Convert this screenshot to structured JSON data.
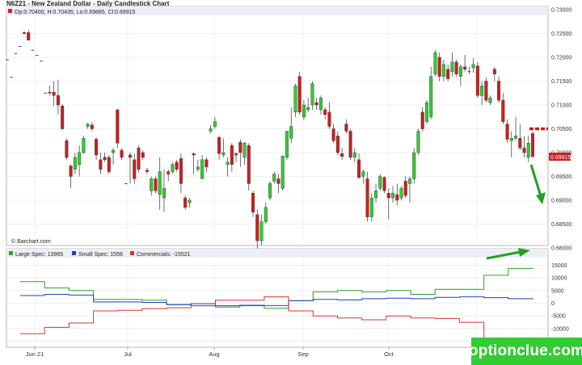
{
  "header": {
    "title": "N6Z21 - New Zealand Dollar - Daily Candlestick Chart",
    "ohlc": "Op:0.70400, H:0.70435, Lo:0.69885, Cl:0.69915",
    "last_price": "0.69915",
    "copyright": "© Barchart.com"
  },
  "watermark": "optionclue.com",
  "colors": {
    "up": "#33cc33",
    "down": "#cc1f1f",
    "large_spec": "#2ca02c",
    "small_spec": "#1f3fbf",
    "commercials": "#e0302a",
    "arrow": "#22a022",
    "level": "#dd1111"
  },
  "chart_data": [
    {
      "type": "candlestick",
      "title": "N6Z21 - New Zealand Dollar - Daily Candlestick Chart",
      "x_ticks": [
        "Jun 21",
        "Jul",
        "Aug",
        "Sep",
        "Oct"
      ],
      "ylim": [
        0.68,
        0.73
      ],
      "y_ticks": [
        "0.73000",
        "0.72500",
        "0.72000",
        "0.71500",
        "0.71000",
        "0.70500",
        "0.70000",
        "0.69500",
        "0.69000",
        "0.68500",
        "0.68000"
      ],
      "horizontal_level": 0.705,
      "last_price_label": "0.69915",
      "candles": [
        [
          0.7195,
          0.7195,
          0.7195,
          0.7195
        ],
        [
          0.7158,
          0.7158,
          0.7158,
          0.7158
        ],
        [
          0.7208,
          0.7208,
          0.7208,
          0.7208
        ],
        [
          0.7223,
          0.7223,
          0.7223,
          0.7223
        ],
        [
          0.7252,
          0.7255,
          0.7248,
          0.725
        ],
        [
          0.7252,
          0.7258,
          0.7235,
          0.7236
        ],
        [
          0.7215,
          0.7215,
          0.7215,
          0.7215
        ],
        [
          0.7204,
          0.7204,
          0.7204,
          0.7204
        ],
        [
          0.7192,
          0.7192,
          0.7192,
          0.7192
        ],
        [
          0.7125,
          0.7125,
          0.7125,
          0.7125
        ],
        [
          0.7127,
          0.714,
          0.712,
          0.7125
        ],
        [
          0.7127,
          0.715,
          0.7098,
          0.712
        ],
        [
          0.712,
          0.7153,
          0.708,
          0.71
        ],
        [
          0.7098,
          0.7102,
          0.7048,
          0.705
        ],
        [
          0.7025,
          0.703,
          0.6985,
          0.699
        ],
        [
          0.6972,
          0.6975,
          0.6925,
          0.695
        ],
        [
          0.6965,
          0.7,
          0.6955,
          0.699
        ],
        [
          0.6975,
          0.7015,
          0.695,
          0.7
        ],
        [
          0.7,
          0.7035,
          0.6998,
          0.703
        ],
        [
          0.7055,
          0.7062,
          0.705,
          0.706
        ],
        [
          0.7058,
          0.7064,
          0.7045,
          0.705
        ],
        [
          0.7028,
          0.7032,
          0.6985,
          0.6995
        ],
        [
          0.6985,
          0.7,
          0.6955,
          0.6965
        ],
        [
          0.699,
          0.7,
          0.698,
          0.6985
        ],
        [
          0.699,
          0.6995,
          0.6955,
          0.696
        ],
        [
          0.7,
          0.701,
          0.6975,
          0.7005
        ],
        [
          0.709,
          0.709,
          0.701,
          0.702
        ],
        [
          0.7005,
          0.701,
          0.6985,
          0.699
        ],
        [
          0.6935,
          0.6935,
          0.6935,
          0.6935
        ],
        [
          0.6995,
          0.7,
          0.6935,
          0.699
        ],
        [
          0.6985,
          0.6998,
          0.6935,
          0.6945
        ],
        [
          0.701,
          0.7015,
          0.6958,
          0.6965
        ],
        [
          0.7,
          0.7005,
          0.6985,
          0.699
        ],
        [
          0.6963,
          0.6968,
          0.6955,
          0.696
        ],
        [
          0.692,
          0.695,
          0.691,
          0.6945
        ],
        [
          0.6945,
          0.695,
          0.6915,
          0.692
        ],
        [
          0.6912,
          0.699,
          0.688,
          0.696
        ],
        [
          0.6905,
          0.6965,
          0.6875,
          0.6925
        ],
        [
          0.696,
          0.6965,
          0.694,
          0.6955
        ],
        [
          0.696,
          0.698,
          0.6955,
          0.6975
        ],
        [
          0.698,
          0.6985,
          0.696,
          0.6965
        ],
        [
          0.6988,
          0.6998,
          0.6915,
          0.6935
        ],
        [
          0.6905,
          0.691,
          0.688,
          0.6885
        ],
        [
          0.6895,
          0.6905,
          0.6885,
          0.69
        ],
        [
          0.6998,
          0.7,
          0.6955,
          0.6995
        ],
        [
          0.6965,
          0.6985,
          0.696,
          0.697
        ],
        [
          0.6945,
          0.6995,
          0.6945,
          0.6985
        ],
        [
          0.6985,
          0.699,
          0.696,
          0.697
        ],
        [
          0.7045,
          0.7058,
          0.704,
          0.705
        ],
        [
          0.7055,
          0.7075,
          0.705,
          0.7065
        ],
        [
          0.7032,
          0.7035,
          0.6985,
          0.6998
        ],
        [
          0.6995,
          0.703,
          0.699,
          0.7
        ],
        [
          0.6975,
          0.699,
          0.695,
          0.698
        ],
        [
          0.7015,
          0.702,
          0.696,
          0.6975
        ],
        [
          0.6998,
          0.7,
          0.698,
          0.6995
        ],
        [
          0.7022,
          0.7028,
          0.697,
          0.7
        ],
        [
          0.699,
          0.7022,
          0.6975,
          0.702
        ],
        [
          0.7015,
          0.702,
          0.692,
          0.6935
        ],
        [
          0.6915,
          0.692,
          0.6865,
          0.6875
        ],
        [
          0.687,
          0.688,
          0.6795,
          0.6815
        ],
        [
          0.6815,
          0.687,
          0.6805,
          0.6855
        ],
        [
          0.6855,
          0.6895,
          0.685,
          0.6885
        ],
        [
          0.6905,
          0.694,
          0.69,
          0.6935
        ],
        [
          0.694,
          0.696,
          0.6935,
          0.6955
        ],
        [
          0.6945,
          0.6955,
          0.6915,
          0.6935
        ],
        [
          0.6925,
          0.6993,
          0.692,
          0.6993
        ],
        [
          0.699,
          0.7045,
          0.6985,
          0.7045
        ],
        [
          0.703,
          0.7095,
          0.702,
          0.7055
        ],
        [
          0.7085,
          0.7145,
          0.7075,
          0.714
        ],
        [
          0.716,
          0.717,
          0.708,
          0.7085
        ],
        [
          0.7075,
          0.711,
          0.7068,
          0.71
        ],
        [
          0.709,
          0.7115,
          0.7085,
          0.7095
        ],
        [
          0.71,
          0.715,
          0.709,
          0.7145
        ],
        [
          0.7105,
          0.7115,
          0.709,
          0.71
        ],
        [
          0.709,
          0.712,
          0.708,
          0.7115
        ],
        [
          0.709,
          0.7095,
          0.707,
          0.708
        ],
        [
          0.7085,
          0.7105,
          0.705,
          0.7055
        ],
        [
          0.705,
          0.706,
          0.702,
          0.7025
        ],
        [
          0.7035,
          0.7045,
          0.6995,
          0.7
        ],
        [
          0.6998,
          0.701,
          0.6985,
          0.6992
        ],
        [
          0.706,
          0.707,
          0.704,
          0.7045
        ],
        [
          0.7045,
          0.705,
          0.6985,
          0.699
        ],
        [
          0.699,
          0.701,
          0.698,
          0.7
        ],
        [
          0.6985,
          0.6998,
          0.6945,
          0.6948
        ],
        [
          0.695,
          0.6965,
          0.6935,
          0.696
        ],
        [
          0.6945,
          0.696,
          0.6855,
          0.6865
        ],
        [
          0.6865,
          0.6915,
          0.6855,
          0.6905
        ],
        [
          0.6905,
          0.6935,
          0.6895,
          0.692
        ],
        [
          0.6925,
          0.6955,
          0.692,
          0.695
        ],
        [
          0.6948,
          0.695,
          0.6915,
          0.692
        ],
        [
          0.6915,
          0.6925,
          0.686,
          0.6905
        ],
        [
          0.6905,
          0.693,
          0.6895,
          0.6915
        ],
        [
          0.6912,
          0.6935,
          0.689,
          0.69
        ],
        [
          0.6905,
          0.693,
          0.69,
          0.6925
        ],
        [
          0.694,
          0.695,
          0.6905,
          0.691
        ],
        [
          0.6935,
          0.695,
          0.6895,
          0.6945
        ],
        [
          0.6945,
          0.701,
          0.6935,
          0.7
        ],
        [
          0.7,
          0.705,
          0.6995,
          0.7045
        ],
        [
          0.7085,
          0.7095,
          0.7045,
          0.705
        ],
        [
          0.7065,
          0.711,
          0.706,
          0.7105
        ],
        [
          0.7075,
          0.718,
          0.707,
          0.716
        ],
        [
          0.7165,
          0.7215,
          0.716,
          0.721
        ],
        [
          0.72,
          0.721,
          0.715,
          0.716
        ],
        [
          0.716,
          0.7195,
          0.715,
          0.7185
        ],
        [
          0.7175,
          0.7185,
          0.715,
          0.7155
        ],
        [
          0.717,
          0.721,
          0.716,
          0.719
        ],
        [
          0.719,
          0.7195,
          0.716,
          0.7165
        ],
        [
          0.716,
          0.7185,
          0.714,
          0.718
        ],
        [
          0.718,
          0.7205,
          0.717,
          0.7175
        ],
        [
          0.717,
          0.718,
          0.7165,
          0.717
        ],
        [
          0.7178,
          0.7198,
          0.7168,
          0.7185
        ],
        [
          0.7182,
          0.719,
          0.7115,
          0.712
        ],
        [
          0.712,
          0.715,
          0.71,
          0.714
        ],
        [
          0.715,
          0.7158,
          0.7105,
          0.711
        ],
        [
          0.7105,
          0.712,
          0.71,
          0.7115
        ],
        [
          0.7175,
          0.718,
          0.715,
          0.7165
        ],
        [
          0.715,
          0.716,
          0.7105,
          0.711
        ],
        [
          0.711,
          0.7125,
          0.706,
          0.7065
        ],
        [
          0.706,
          0.707,
          0.702,
          0.7028
        ],
        [
          0.7025,
          0.7045,
          0.699,
          0.703
        ],
        [
          0.703,
          0.7075,
          0.7025,
          0.7035
        ],
        [
          0.703,
          0.706,
          0.7005,
          0.701
        ],
        [
          0.701,
          0.7035,
          0.699,
          0.7
        ],
        [
          0.699,
          0.7035,
          0.698,
          0.702
        ],
        [
          0.704,
          0.7044,
          0.6988,
          0.6992
        ]
      ]
    },
    {
      "type": "line",
      "subtype": "step",
      "title": "COT positions",
      "x_ticks": [
        "Jun 21",
        "Jul",
        "Aug",
        "Sep",
        "Oct"
      ],
      "ylim": [
        -17000,
        17000
      ],
      "y_ticks": [
        "15000",
        "10000",
        "5000",
        "0",
        "-5000",
        "-10000",
        "-15000"
      ],
      "series": [
        {
          "name": "Large Spec: 13965",
          "values": [
            8500,
            6000,
            5000,
            1500,
            1500,
            1200,
            -600,
            -1000,
            -1500,
            -1000,
            -2000,
            1000,
            4500,
            5000,
            4500,
            5000,
            3500,
            5500,
            5500,
            11000,
            13700,
            13965
          ]
        },
        {
          "name": "Small Spec: 1556",
          "values": [
            3000,
            3500,
            3200,
            500,
            500,
            300,
            -500,
            -200,
            -1000,
            -800,
            -900,
            1000,
            1500,
            1300,
            1800,
            2000,
            1800,
            2300,
            2500,
            2200,
            1800,
            1556
          ]
        },
        {
          "name": "Commercials: -15521",
          "values": [
            -12000,
            -9500,
            -7800,
            -3000,
            -2800,
            -2100,
            -1800,
            -1000,
            1200,
            1200,
            2500,
            -3000,
            -5000,
            -5800,
            -6500,
            -5000,
            -5800,
            -6000,
            -7500,
            -14500,
            -14800,
            -15521
          ]
        }
      ]
    }
  ]
}
